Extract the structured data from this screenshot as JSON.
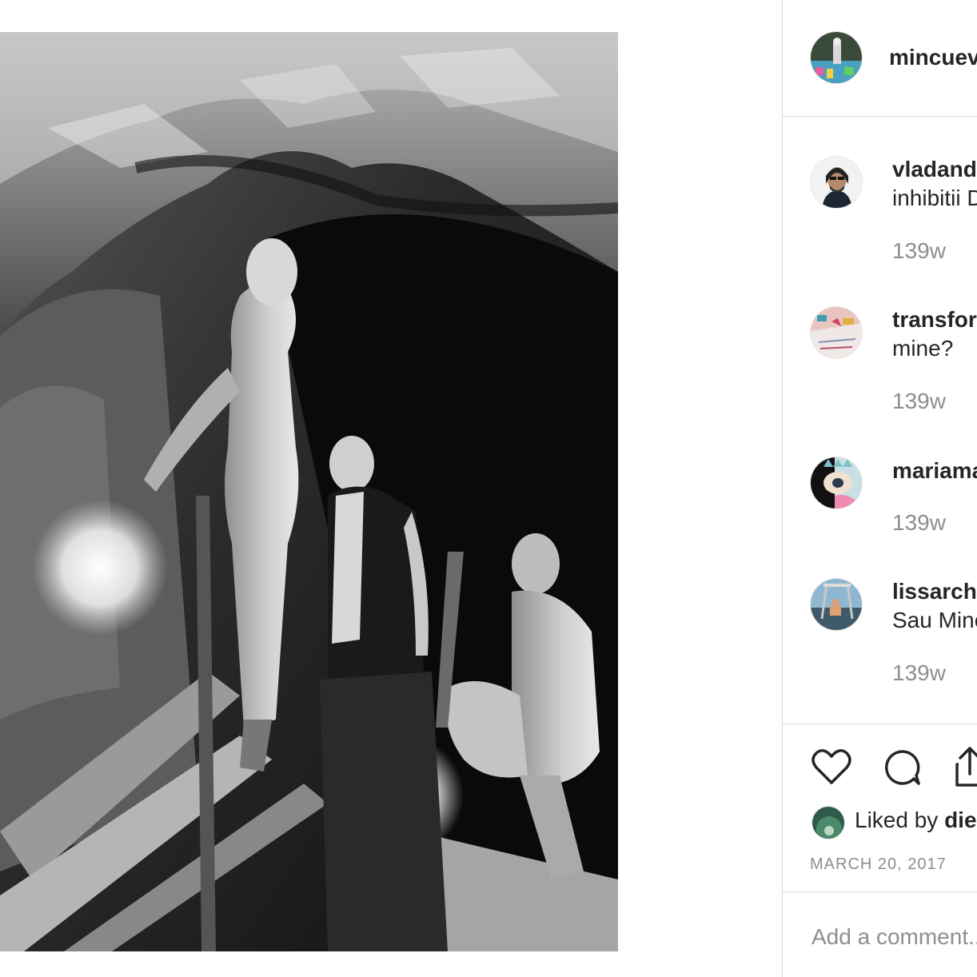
{
  "post": {
    "author": "mincuev",
    "image_description_icon": "photo"
  },
  "comments": [
    {
      "username": "vladand",
      "text": "inhibitii D",
      "time": "139w",
      "avatar_icon": "avatar-bearded-man"
    },
    {
      "username": "transfor",
      "text": "mine?",
      "time": "139w",
      "avatar_icon": "avatar-artwork"
    },
    {
      "username": "mariama",
      "text": "",
      "time": "139w",
      "avatar_icon": "avatar-illustration"
    },
    {
      "username": "lissarch",
      "text": "Sau Mine",
      "time": "139w",
      "avatar_icon": "avatar-swing"
    }
  ],
  "actions": {
    "like_icon": "heart-icon",
    "comment_icon": "comment-bubble-icon",
    "share_icon": "share-icon"
  },
  "likes": {
    "prefix": "Liked by ",
    "name": "die"
  },
  "date": "MARCH 20, 2017",
  "add_comment": {
    "placeholder": "Add a comment..."
  },
  "colors": {
    "border": "#dbdbdb",
    "text": "#262626",
    "muted": "#8e8e8e"
  }
}
